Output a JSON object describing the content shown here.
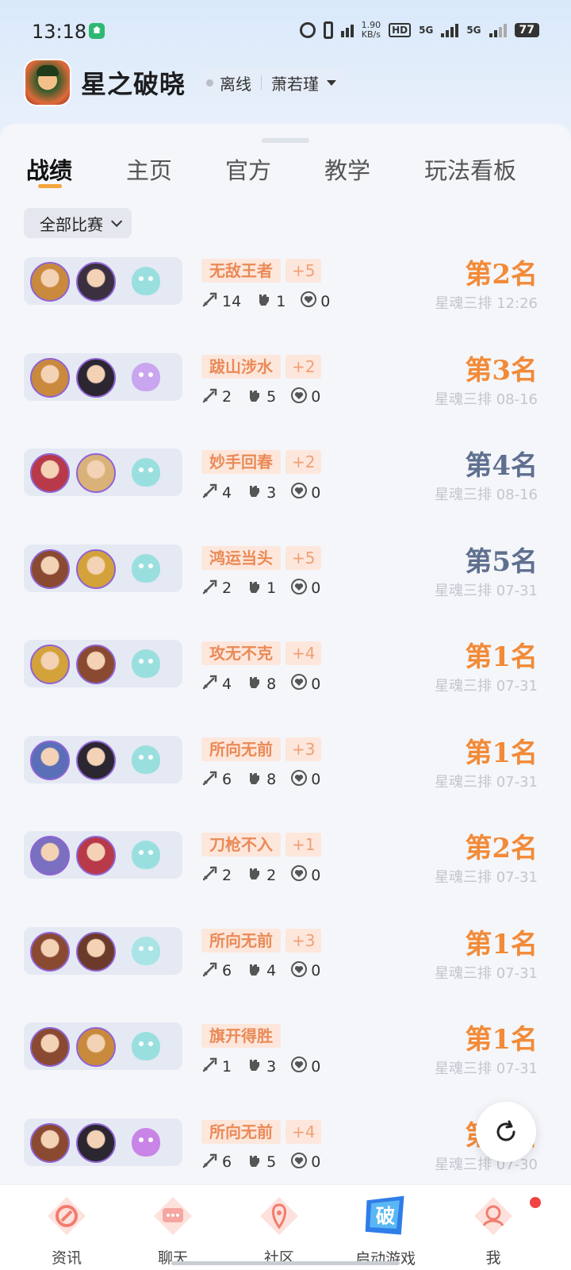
{
  "status_bar": {
    "time": "13:18",
    "net_speed_value": "1.90",
    "net_speed_unit": "KB/s",
    "hd_label": "HD",
    "net1": "5G",
    "net2": "5G",
    "battery": "77"
  },
  "header": {
    "game_title": "星之破晓",
    "status": "离线",
    "account_name": "萧若瑾"
  },
  "tabs": [
    {
      "label": "战绩",
      "active": true
    },
    {
      "label": "主页",
      "active": false
    },
    {
      "label": "官方",
      "active": false
    },
    {
      "label": "教学",
      "active": false
    },
    {
      "label": "玩法看板",
      "active": false
    }
  ],
  "filter": {
    "label": "全部比赛"
  },
  "colors": {
    "rank_orange": "#f28a37",
    "rank_slate": "#5f6f8f",
    "badge_bg": "#fde7dc",
    "badge_text": "#ea8a57",
    "tab_underline": "#f4a53c"
  },
  "matches": [
    {
      "title": "无敌王者",
      "score": "+5",
      "kills": "14",
      "deaths": "1",
      "assists": "0",
      "rank": "第2名",
      "rank_color": "orange",
      "mode": "星魂三排",
      "time": "12:26",
      "hero1": "#c98a3e",
      "hero2": "#3a3040",
      "pet": "#9adfe0"
    },
    {
      "title": "跋山涉水",
      "score": "+2",
      "kills": "2",
      "deaths": "5",
      "assists": "0",
      "rank": "第3名",
      "rank_color": "orange",
      "mode": "星魂三排",
      "time": "08-16",
      "hero1": "#c98a3e",
      "hero2": "#2b2630",
      "pet": "#c9a6ef"
    },
    {
      "title": "妙手回春",
      "score": "+2",
      "kills": "4",
      "deaths": "3",
      "assists": "0",
      "rank": "第4名",
      "rank_color": "slate",
      "mode": "星魂三排",
      "time": "08-16",
      "hero1": "#b8394a",
      "hero2": "#d9b27a",
      "pet": "#9adfe0"
    },
    {
      "title": "鸿运当头",
      "score": "+5",
      "kills": "2",
      "deaths": "1",
      "assists": "0",
      "rank": "第5名",
      "rank_color": "slate",
      "mode": "星魂三排",
      "time": "07-31",
      "hero1": "#8a4a32",
      "hero2": "#d3a23b",
      "pet": "#9adfe0"
    },
    {
      "title": "攻无不克",
      "score": "+4",
      "kills": "4",
      "deaths": "8",
      "assists": "0",
      "rank": "第1名",
      "rank_color": "orange",
      "mode": "星魂三排",
      "time": "07-31",
      "hero1": "#d3a23b",
      "hero2": "#8a4a32",
      "pet": "#9adfe0"
    },
    {
      "title": "所向无前",
      "score": "+3",
      "kills": "6",
      "deaths": "8",
      "assists": "0",
      "rank": "第1名",
      "rank_color": "orange",
      "mode": "星魂三排",
      "time": "07-31",
      "hero1": "#5a6fb8",
      "hero2": "#2b2630",
      "pet": "#9adfe0"
    },
    {
      "title": "刀枪不入",
      "score": "+1",
      "kills": "2",
      "deaths": "2",
      "assists": "0",
      "rank": "第2名",
      "rank_color": "orange",
      "mode": "星魂三排",
      "time": "07-31",
      "hero1": "#7a6fc0",
      "hero2": "#b8394a",
      "pet": "#9adfe0"
    },
    {
      "title": "所向无前",
      "score": "+3",
      "kills": "6",
      "deaths": "4",
      "assists": "0",
      "rank": "第1名",
      "rank_color": "orange",
      "mode": "星魂三排",
      "time": "07-31",
      "hero1": "#8a4a32",
      "hero2": "#6b3a2a",
      "pet": "#a9e4e6"
    },
    {
      "title": "旗开得胜",
      "score": "",
      "kills": "1",
      "deaths": "3",
      "assists": "0",
      "rank": "第1名",
      "rank_color": "orange",
      "mode": "星魂三排",
      "time": "07-31",
      "hero1": "#8a4a32",
      "hero2": "#c98a3e",
      "pet": "#9adfe0"
    },
    {
      "title": "所向无前",
      "score": "+4",
      "kills": "6",
      "deaths": "5",
      "assists": "0",
      "rank": "第1名",
      "rank_color": "orange",
      "mode": "星魂三排",
      "time": "07-30",
      "hero1": "#8a4a32",
      "hero2": "#2b2630",
      "pet": "#c884e6"
    }
  ],
  "bottom_nav": [
    {
      "label": "资讯",
      "icon": "news-icon"
    },
    {
      "label": "聊天",
      "icon": "chat-icon"
    },
    {
      "label": "社区",
      "icon": "community-icon"
    },
    {
      "label": "启动游戏",
      "icon": "launch-game-icon"
    },
    {
      "label": "我",
      "icon": "profile-icon"
    }
  ]
}
